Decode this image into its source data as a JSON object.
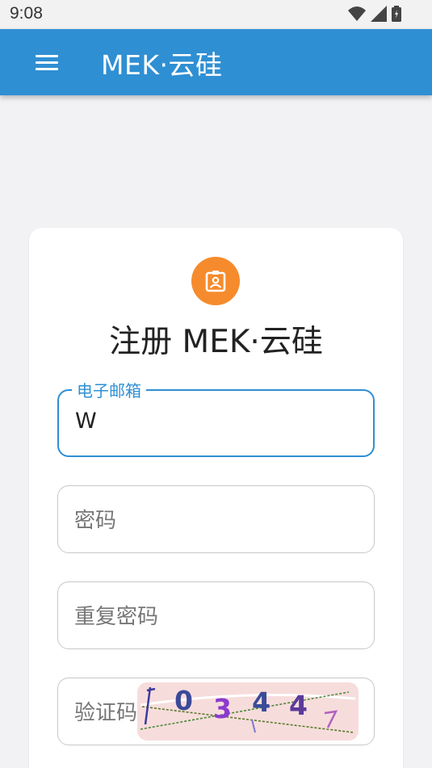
{
  "status_bar": {
    "time": "9:08",
    "icons": [
      "wifi-icon",
      "signal-icon",
      "battery-icon"
    ]
  },
  "app_bar": {
    "menu_icon": "menu-icon",
    "title": "MEK·云硅",
    "color": "#2f8fd3"
  },
  "card": {
    "badge_icon": "contact-card-icon",
    "badge_color": "#f58b2d",
    "title": "注册 MEK·云硅",
    "fields": {
      "email": {
        "label": "电子邮箱",
        "value": "W"
      },
      "password": {
        "placeholder": "密码"
      },
      "confirm_password": {
        "placeholder": "重复密码"
      },
      "captcha": {
        "placeholder": "验证码",
        "captcha_text": "034"
      }
    }
  }
}
